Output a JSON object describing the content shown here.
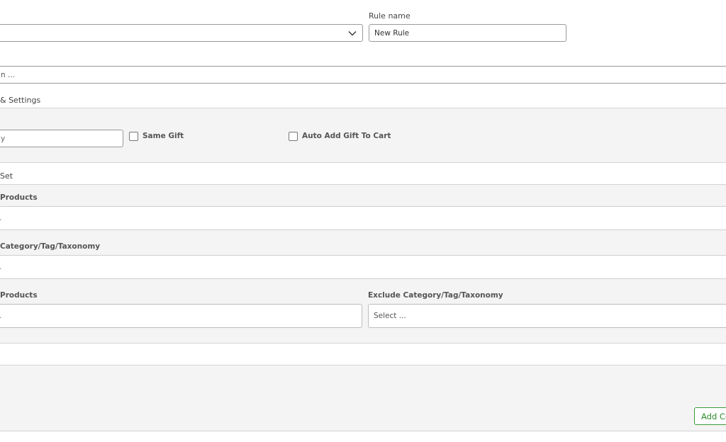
{
  "top": {
    "rule_name_label": "Rule name",
    "rule_name_value": "New Rule",
    "type_select_value": ""
  },
  "description": {
    "placeholder_fragment": "n ..."
  },
  "section": {
    "title_fragment": "& Settings"
  },
  "gift": {
    "quantity_fragment": "y",
    "same_gift_label": "Same Gift",
    "auto_add_label": "Auto Add Gift To Cart"
  },
  "rows": {
    "set_fragment": "Set",
    "products_label_fragment": "Products",
    "products_value_fragment": ".",
    "category_label_fragment": "Category/Tag/Taxonomy",
    "category_value_fragment": ".",
    "exclude_products_label_fragment": "Products",
    "exclude_products_value_fragment": ".",
    "exclude_category_label": "Exclude Category/Tag/Taxonomy",
    "exclude_category_placeholder": "Select ..."
  },
  "actions": {
    "add_button_fragment": "Add Co"
  },
  "icons": {
    "select_chevron": "chevron-down-icon"
  }
}
